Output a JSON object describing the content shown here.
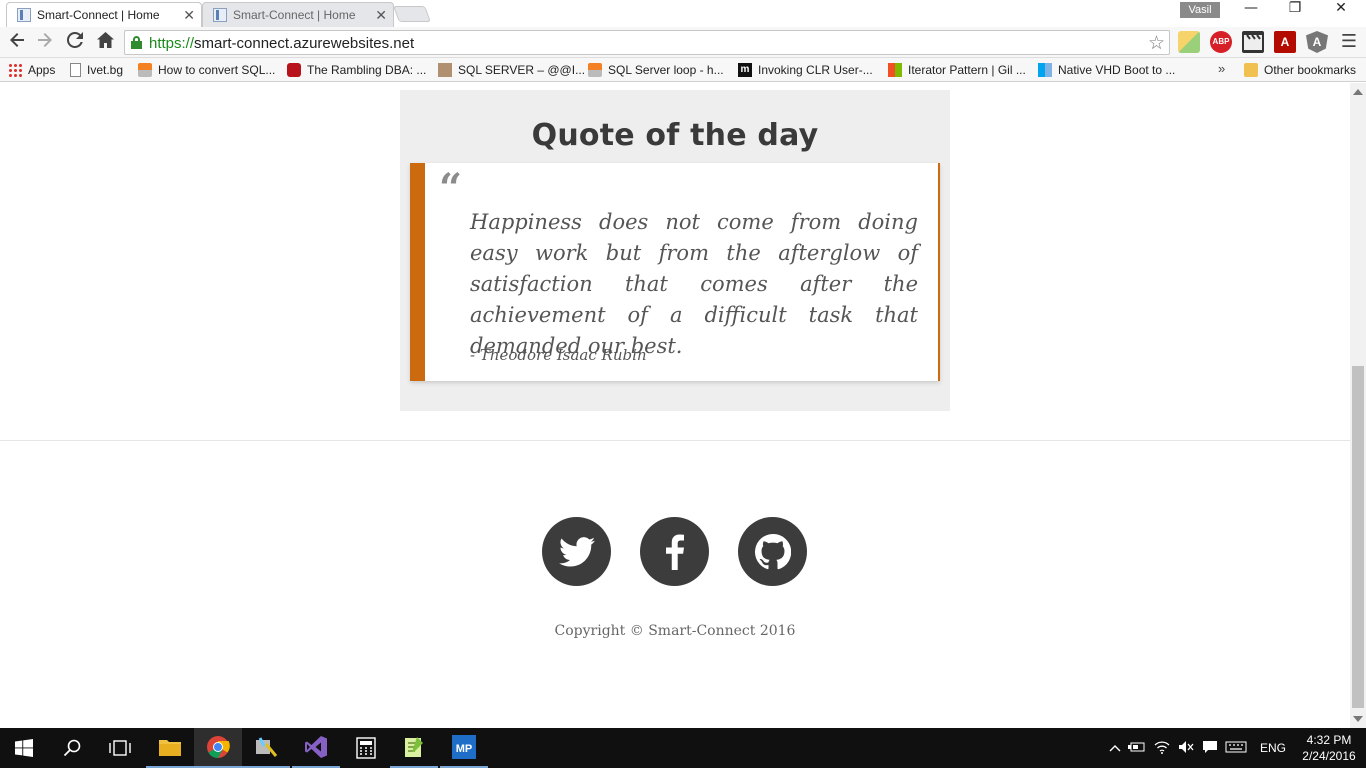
{
  "browser": {
    "tabs": [
      {
        "title": "Smart-Connect | Home",
        "active": true
      },
      {
        "title": "Smart-Connect | Home",
        "active": false
      }
    ],
    "profile_name": "Vasil",
    "url_scheme": "https://",
    "url_host": "smart-connect.azurewebsites.net",
    "bookmarks": [
      {
        "label": "Apps",
        "icon": "apps-grid-icon"
      },
      {
        "label": "Ivet.bg",
        "icon": "page-icon"
      },
      {
        "label": "How to convert SQL...",
        "icon": "stackoverflow-icon"
      },
      {
        "label": "The Rambling DBA: ...",
        "icon": "red-site-icon"
      },
      {
        "label": "SQL SERVER – @@I...",
        "icon": "photo-icon"
      },
      {
        "label": "SQL Server loop - h...",
        "icon": "stackoverflow-icon"
      },
      {
        "label": "Invoking CLR User-...",
        "icon": "m-icon"
      },
      {
        "label": "Iterator Pattern | Gil ...",
        "icon": "microsoft-icon"
      },
      {
        "label": "Native VHD Boot to ...",
        "icon": "windows-icon"
      }
    ],
    "other_bookmarks": "Other bookmarks",
    "more_bookmarks": "»"
  },
  "page": {
    "quote_title": "Quote of the day",
    "quote_mark": "“",
    "quote_text": "Happiness does not come from doing easy work but from the afterglow of satisfaction that comes after the achievement of a difficult task that demanded our best.",
    "quote_author": "- Theodore Isaac Rubin",
    "social": [
      "twitter",
      "facebook",
      "github"
    ],
    "copyright": "Copyright © Smart-Connect 2016"
  },
  "taskbar": {
    "language": "ENG",
    "time": "4:32 PM",
    "date": "2/24/2016"
  },
  "colors": {
    "accent": "#cc6a10",
    "social_bg": "#3c3c3c",
    "panel_bg": "#eeeeee"
  }
}
